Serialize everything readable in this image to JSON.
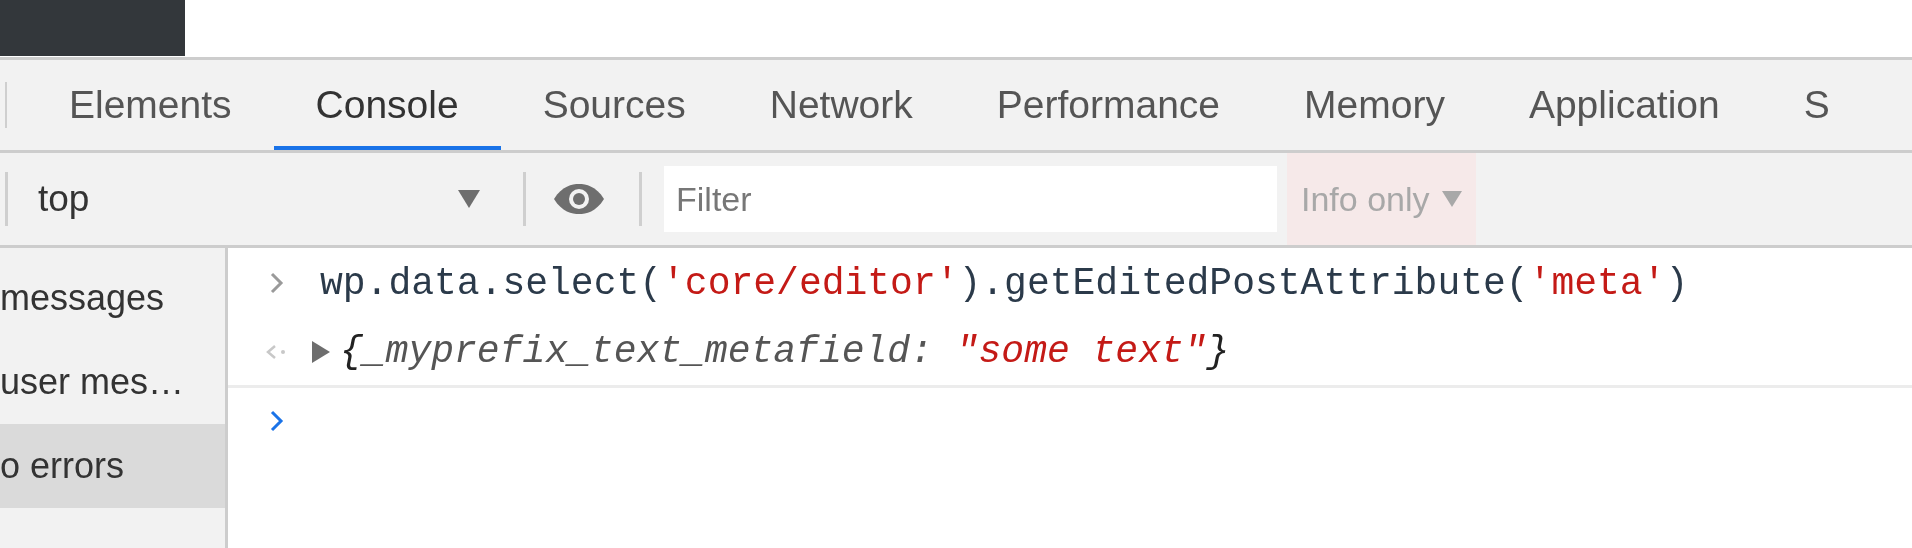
{
  "tabs": [
    {
      "label": "Elements",
      "selected": false
    },
    {
      "label": "Console",
      "selected": true
    },
    {
      "label": "Sources",
      "selected": false
    },
    {
      "label": "Network",
      "selected": false
    },
    {
      "label": "Performance",
      "selected": false
    },
    {
      "label": "Memory",
      "selected": false
    },
    {
      "label": "Application",
      "selected": false
    },
    {
      "label": "S",
      "selected": false
    }
  ],
  "toolbar": {
    "context": "top",
    "filter": {
      "placeholder": "Filter"
    },
    "levels": "Info only"
  },
  "sidebar": {
    "items": [
      {
        "label": "messages",
        "selected": false
      },
      {
        "label": "user mes…",
        "selected": false
      },
      {
        "label": "o errors",
        "selected": true
      }
    ]
  },
  "console": {
    "entries": [
      {
        "kind": "input",
        "parts": [
          {
            "kind": "plain",
            "text": "wp.data.select("
          },
          {
            "kind": "string",
            "text": "'core/editor'"
          },
          {
            "kind": "plain",
            "text": ").getEditedPostAttribute("
          },
          {
            "kind": "string",
            "text": "'meta'"
          },
          {
            "kind": "plain",
            "text": ")"
          }
        ]
      },
      {
        "kind": "output",
        "parts": [
          {
            "kind": "punct",
            "text": "{"
          },
          {
            "kind": "key",
            "text": "_myprefix_text_metafield: "
          },
          {
            "kind": "string",
            "text": "\"some text\""
          },
          {
            "kind": "punct",
            "text": "}"
          }
        ]
      },
      {
        "kind": "prompt"
      }
    ]
  }
}
